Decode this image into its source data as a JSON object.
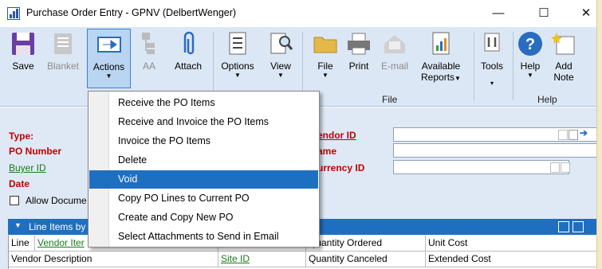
{
  "window": {
    "title": "Purchase Order Entry  -  GPNV (DelbertWenger)",
    "controls": {
      "minimize": "—",
      "maximize": "☐",
      "close": "✕"
    }
  },
  "ribbon": {
    "buttons": {
      "save": "Save",
      "blanket": "Blanket",
      "actions": "Actions",
      "aa": "AA",
      "attach": "Attach",
      "options": "Options",
      "view": "View",
      "file": "File",
      "print": "Print",
      "email": "E-mail",
      "available_reports_1": "Available",
      "available_reports_2": "Reports",
      "tools": "Tools",
      "help": "Help",
      "add_note_1": "Add",
      "add_note_2": "Note"
    },
    "groups": {
      "file": "File",
      "help": "Help"
    },
    "colors": {
      "ribbon_bg": "#dbe7f5",
      "active_border": "#3a7fd0",
      "highlight": "#1f6fc0"
    }
  },
  "form": {
    "labels": {
      "type": "Type:",
      "po_number": "PO Number",
      "buyer_id": "Buyer ID",
      "date": "Date",
      "allow_documents": "Allow Docume",
      "vendor_id": "endor ID",
      "name": "ame",
      "currency_id": "urrency ID"
    }
  },
  "line_items": {
    "bar_label": "Line Items by",
    "columns_row1": {
      "line": "Line",
      "vendor_item": "Vendor Iter",
      "quantity_ordered": "Quantity Ordered",
      "unit_cost": "Unit Cost"
    },
    "columns_row2": {
      "vendor_description": "Vendor Description",
      "site_id": "Site ID",
      "quantity_canceled": "Quantity Canceled",
      "extended_cost": "Extended Cost"
    }
  },
  "actions_menu": {
    "items": [
      "Receive the PO Items",
      "Receive and Invoice the PO Items",
      "Invoice the PO Items",
      "Delete",
      "Void",
      "Copy PO Lines to Current PO",
      "Create and Copy New PO",
      "Select Attachments to Send in Email"
    ],
    "highlighted": "Void"
  }
}
